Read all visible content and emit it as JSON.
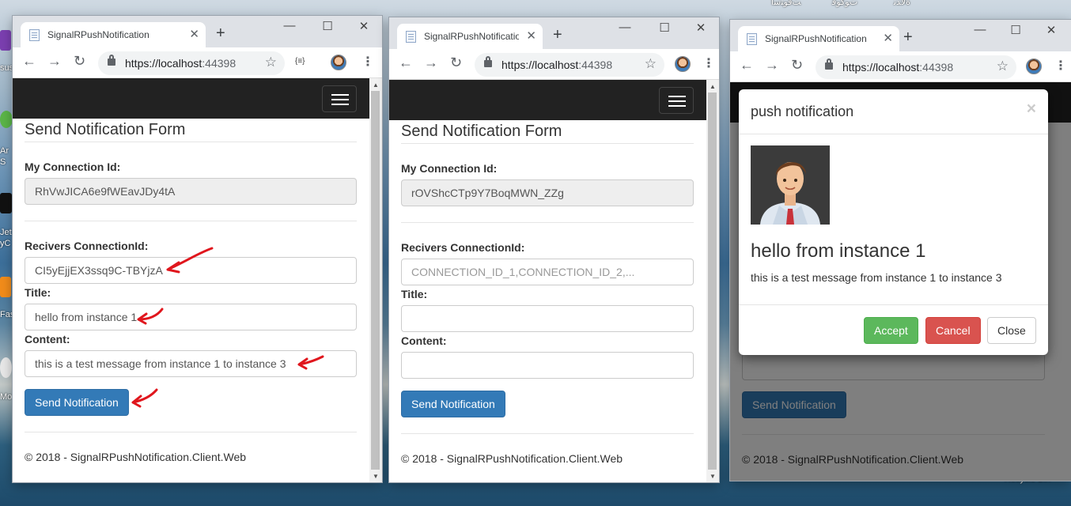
{
  "desktop": {
    "top_labels": [
      "ﺖﻗﻮﺘﺳﺍ",
      "ﺕﻮﻛﻮﻗ",
      "ﺓﻻﺪﻧ"
    ],
    "side_labels": [
      "sus",
      "Ar",
      "S",
      "Jet",
      "yC",
      "Fas",
      "Mo"
    ],
    "recycle_label": "Recycle Bin"
  },
  "colors": {
    "navbar": "#222222",
    "primary": "#337ab7",
    "success": "#5cb85c",
    "danger": "#d9534f",
    "annotation_arrow": "#e0161d"
  },
  "windows": [
    {
      "tab_title": "SignalRPushNotification",
      "url_host": "https://localhost",
      "url_port": ":44398",
      "ext_label": "{≡}",
      "form": {
        "title": "Send Notification Form",
        "my_connection_label": "My Connection Id:",
        "my_connection_value": "RhVwJICA6e9fWEavJDy4tA",
        "receivers_label": "Recivers ConnectionId:",
        "receivers_value": "CI5yEjjEX3ssq9C-TBYjzA",
        "title_label": "Title:",
        "title_value": "hello from instance 1",
        "content_label": "Content:",
        "content_value": "this is a test message from  instance 1 to  instance 3",
        "send_button": "Send Notification"
      },
      "footer": "© 2018 - SignalRPushNotification.Client.Web"
    },
    {
      "tab_title": "SignalRPushNotificatio",
      "url_host": "https://localhost",
      "url_port": ":44398",
      "form": {
        "title": "Send Notification Form",
        "my_connection_label": "My Connection Id:",
        "my_connection_value": "rOVShcCTp9Y7BoqMWN_ZZg",
        "receivers_label": "Recivers ConnectionId:",
        "receivers_placeholder": "CONNECTION_ID_1,CONNECTION_ID_2,...",
        "title_label": "Title:",
        "content_label": "Content:",
        "send_button": "Send Notification"
      },
      "footer": "© 2018 - SignalRPushNotification.Client.Web"
    },
    {
      "tab_title": "SignalRPushNotification",
      "url_host": "https://localhost",
      "url_port": ":44398",
      "send_button": "Send Notification",
      "footer": "© 2018 - SignalRPushNotification.Client.Web",
      "modal": {
        "title": "push notification",
        "heading": "hello from instance 1",
        "message": "this is a test message from instance 1 to instance 3",
        "accept_button": "Accept",
        "cancel_button": "Cancel",
        "close_button": "Close"
      }
    }
  ]
}
